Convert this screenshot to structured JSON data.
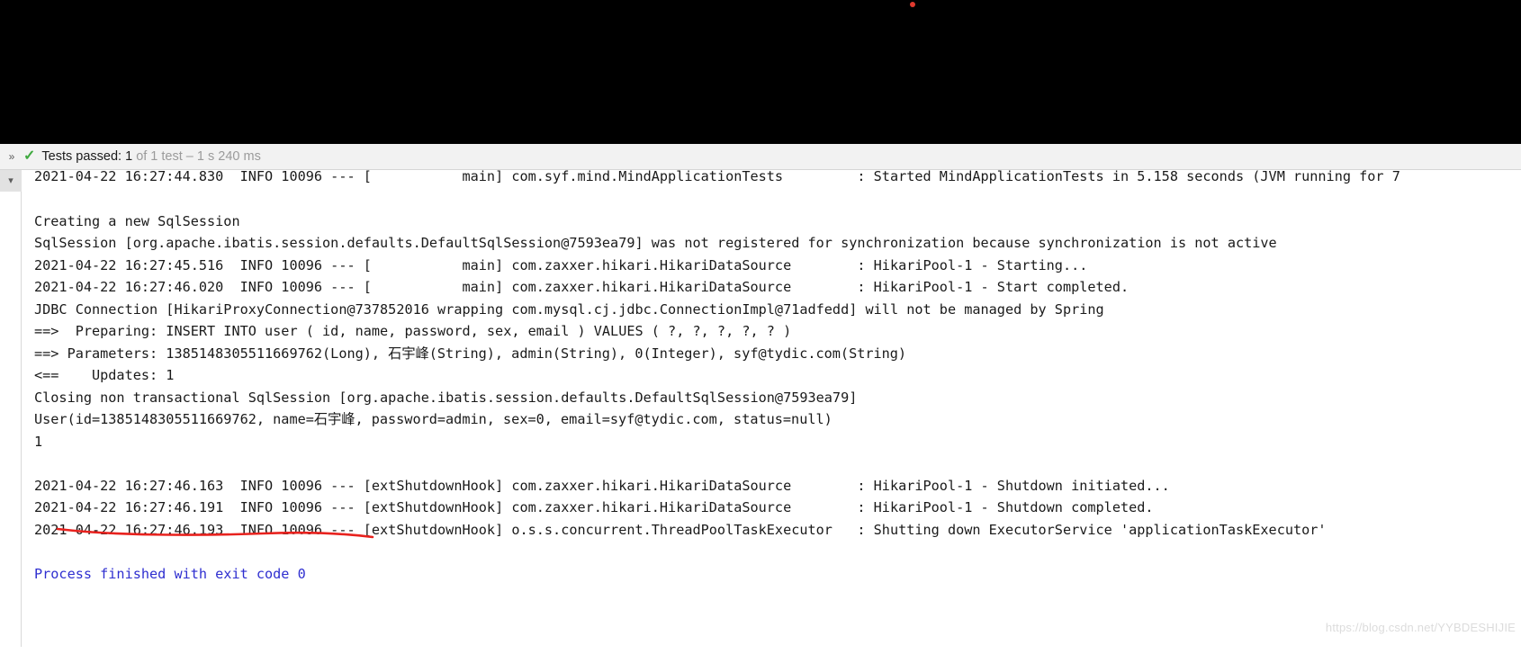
{
  "status_bar": {
    "expand_icon": "chevrons-right-icon",
    "result_icon": "green-check-icon",
    "result_label": "Tests passed: 1",
    "result_detail": "of 1 test – 1 s 240 ms",
    "accent_color": "#3fa93f"
  },
  "gutter": {
    "collapse_icon": "chevron-down-icon"
  },
  "console": {
    "lines": [
      "2021-04-22 16:27:44.830  INFO 10096 --- [           main] com.syf.mind.MindApplicationTests         : Started MindApplicationTests in 5.158 seconds (JVM running for 7",
      "",
      "Creating a new SqlSession",
      "SqlSession [org.apache.ibatis.session.defaults.DefaultSqlSession@7593ea79] was not registered for synchronization because synchronization is not active",
      "2021-04-22 16:27:45.516  INFO 10096 --- [           main] com.zaxxer.hikari.HikariDataSource        : HikariPool-1 - Starting...",
      "2021-04-22 16:27:46.020  INFO 10096 --- [           main] com.zaxxer.hikari.HikariDataSource        : HikariPool-1 - Start completed.",
      "JDBC Connection [HikariProxyConnection@737852016 wrapping com.mysql.cj.jdbc.ConnectionImpl@71adfedd] will not be managed by Spring",
      "==>  Preparing: INSERT INTO user ( id, name, password, sex, email ) VALUES ( ?, ?, ?, ?, ? )",
      "==> Parameters: 1385148305511669762(Long), 石宇峰(String), admin(String), 0(Integer), syf@tydic.com(String)",
      "<==    Updates: 1",
      "Closing non transactional SqlSession [org.apache.ibatis.session.defaults.DefaultSqlSession@7593ea79]",
      "User(id=1385148305511669762, name=石宇峰, password=admin, sex=0, email=syf@tydic.com, status=null)",
      "1",
      "",
      "2021-04-22 16:27:46.163  INFO 10096 --- [extShutdownHook] com.zaxxer.hikari.HikariDataSource        : HikariPool-1 - Shutdown initiated...",
      "2021-04-22 16:27:46.191  INFO 10096 --- [extShutdownHook] com.zaxxer.hikari.HikariDataSource        : HikariPool-1 - Shutdown completed.",
      "2021-04-22 16:27:46.193  INFO 10096 --- [extShutdownHook] o.s.s.concurrent.ThreadPoolTaskExecutor   : Shutting down ExecutorService 'applicationTaskExecutor'",
      "",
      "Process finished with exit code 0"
    ],
    "exit_line_index": 18,
    "exit_line_color": "#2f2fd0"
  },
  "annotation": {
    "name": "red-underline-annotation",
    "target_text": "Parameters: 1385148305511669762(Long)",
    "color": "#e8221e"
  },
  "watermark": {
    "text": "https://blog.csdn.net/YYBDESHIJIE",
    "color": "#dcdcdc"
  },
  "marker": {
    "red_dot_color": "#e03a2f"
  }
}
